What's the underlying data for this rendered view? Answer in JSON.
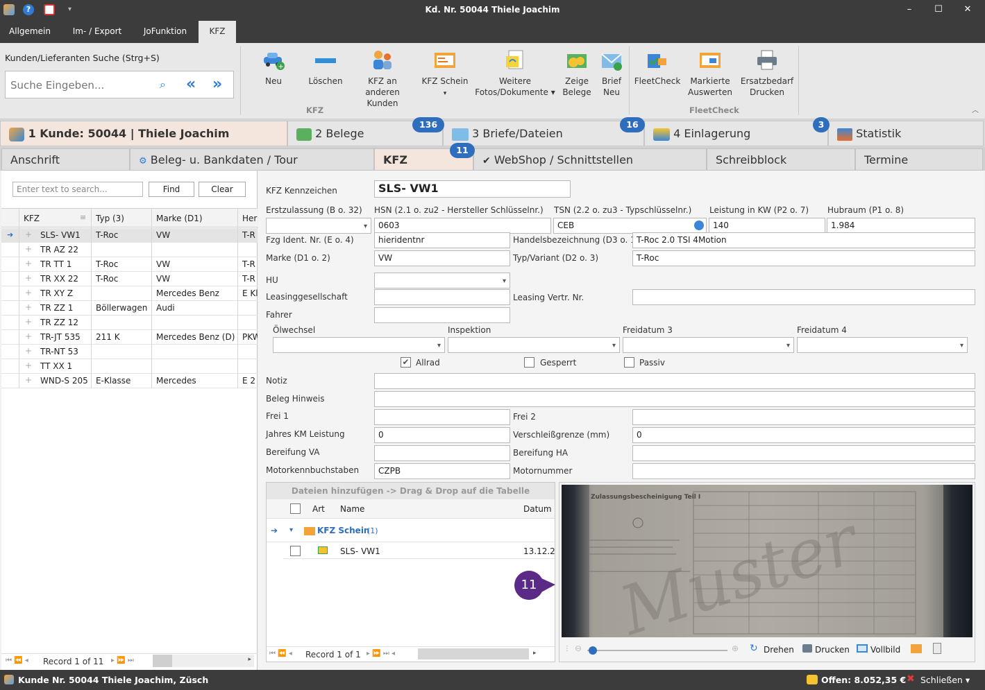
{
  "window": {
    "title": "Kd. Nr. 50044 Thiele Joachim",
    "minimize": "–",
    "maximize": "☐",
    "close": "✕"
  },
  "menu": {
    "tabs": [
      "Allgemein",
      "Im- / Export",
      "JoFunktion",
      "KFZ"
    ]
  },
  "ribbon": {
    "search_label": "Kunden/Lieferanten Suche (Strg+S)",
    "search_placeholder": "Suche Eingeben...",
    "buttons": {
      "neu": "Neu",
      "loeschen": "Löschen",
      "kfz_an_l1": "KFZ an anderen",
      "kfz_an_l2": "Kunden",
      "kfz_schein": "KFZ Schein",
      "weitere_l1": "Weitere",
      "weitere_l2": "Fotos/Dokumente ▾",
      "zeige_l1": "Zeige",
      "zeige_l2": "Belege",
      "brief_l1": "Brief",
      "brief_l2": "Neu",
      "fleetcheck": "FleetCheck",
      "markierte_l1": "Markierte",
      "markierte_l2": "Auswerten",
      "ersatz_l1": "Ersatzbedarf",
      "ersatz_l2": "Drucken"
    },
    "groups": {
      "kfz": "KFZ",
      "fleetcheck": "FleetCheck"
    }
  },
  "primary_tabs": {
    "kunde": "1 Kunde: 50044 | Thiele Joachim",
    "belege": "2 Belege",
    "belege_badge": "136",
    "briefe": "3 Briefe/Dateien",
    "briefe_badge": "16",
    "einlagerung": "4 Einlagerung",
    "einlagerung_badge": "3",
    "statistik": "Statistik"
  },
  "secondary_tabs": {
    "anschrift": "Anschrift",
    "beleg": "Beleg- u. Bankdaten / Tour",
    "kfz": "KFZ",
    "kfz_badge": "11",
    "webshop": "WebShop / Schnittstellen",
    "schreibblock": "Schreibblock",
    "termine": "Termine"
  },
  "left": {
    "search_placeholder": "Enter text to search...",
    "find": "Find",
    "clear": "Clear",
    "columns": [
      "KFZ",
      "Typ (3)",
      "Marke (D1)",
      "Her"
    ],
    "rows": [
      [
        "SLS- VW1",
        "T-Roc",
        "VW",
        "T-R"
      ],
      [
        "TR AZ 22",
        "",
        "",
        ""
      ],
      [
        "TR TT 1",
        "T-Roc",
        "VW",
        "T-R"
      ],
      [
        "TR XX 22",
        "T-Roc",
        "VW",
        "T-R"
      ],
      [
        "TR XY Z",
        "",
        "Mercedes Benz",
        "E Kl"
      ],
      [
        "TR ZZ 1",
        "Böllerwagen",
        "Audi",
        ""
      ],
      [
        "TR ZZ 12",
        "",
        "",
        ""
      ],
      [
        "TR-JT 535",
        "211 K",
        "Mercedes Benz (D)",
        "PKW"
      ],
      [
        "TR-NT 53",
        "",
        "",
        ""
      ],
      [
        "TT XX 1",
        "",
        "",
        ""
      ],
      [
        "WND-S 205",
        "E-Klasse",
        "Mercedes",
        "E 2"
      ]
    ],
    "record": "Record 1 of 11"
  },
  "form": {
    "kennzeichen_label": "KFZ Kennzeichen",
    "kennzeichen": "SLS- VW1",
    "erstzulassung_label": "Erstzulassung (B o. 32)",
    "erstzulassung": "",
    "hsn_label": "HSN (2.1 o. zu2 - Hersteller Schlüsselnr.)",
    "hsn": "0603",
    "tsn_label": "TSN (2.2 o. zu3 - Typschlüsselnr.)",
    "tsn": "CEB",
    "leistung_label": "Leistung in KW (P2 o. 7)",
    "leistung": "140",
    "hubraum_label": "Hubraum (P1 o. 8)",
    "hubraum": "1.984",
    "fzg_label": "Fzg Ident. Nr. (E o. 4)",
    "fzg": "hieridentnr",
    "handels_label": "Handelsbezeichnung (D3 o. 1",
    "handels": "T-Roc 2.0 TSI 4Motion",
    "marke_label": "Marke (D1 o. 2)",
    "marke": "VW",
    "typ_label": "Typ/Variant (D2 o. 3)",
    "typ": "T-Roc",
    "hu_label": "HU",
    "leasing_label": "Leasinggesellschaft",
    "leasing_vertr_label": "Leasing Vertr. Nr.",
    "fahrer_label": "Fahrer",
    "oelwechsel_label": "Ölwechsel",
    "inspektion_label": "Inspektion",
    "freidatum3_label": "Freidatum 3",
    "freidatum4_label": "Freidatum 4",
    "allrad_label": "Allrad",
    "gesperrt_label": "Gesperrt",
    "passiv_label": "Passiv",
    "notiz_label": "Notiz",
    "beleghinweis_label": "Beleg Hinweis",
    "frei1_label": "Frei 1",
    "frei2_label": "Frei 2",
    "jahreskm_label": "Jahres KM Leistung",
    "jahreskm": "0",
    "verschleiss_label": "Verschleißgrenze (mm)",
    "verschleiss": "0",
    "bereifung_va_label": "Bereifung VA",
    "bereifung_ha_label": "Bereifung HA",
    "motorkenn_label": "Motorkennbuchstaben",
    "motorkenn": "CZPB",
    "motornummer_label": "Motornummer"
  },
  "files": {
    "dropzone": "Dateien hinzufügen -> Drag & Drop auf die Tabelle",
    "col_art": "Art",
    "col_name": "Name",
    "col_datum": "Datum",
    "group": "KFZ Schein",
    "group_count": "(1)",
    "row_name": "SLS- VW1",
    "row_date": "13.12.2",
    "record": "Record 1 of 1"
  },
  "viewer": {
    "doc_title": "Zulassungsbescheinigung Teil I",
    "watermark": "Muster",
    "annotation": "11",
    "drehen": "Drehen",
    "drucken": "Drucken",
    "vollbild": "Vollbild"
  },
  "status": {
    "left": "Kunde Nr. 50044 Thiele Joachim, Züsch",
    "offen": "Offen: 8.052,35 €",
    "schliessen": "Schließen ▾"
  },
  "colors": {
    "dark": "#3c3c3c",
    "accent_tab": "#f5e6dd",
    "badge": "#2f6dbd",
    "annotation": "#5b2a86"
  }
}
